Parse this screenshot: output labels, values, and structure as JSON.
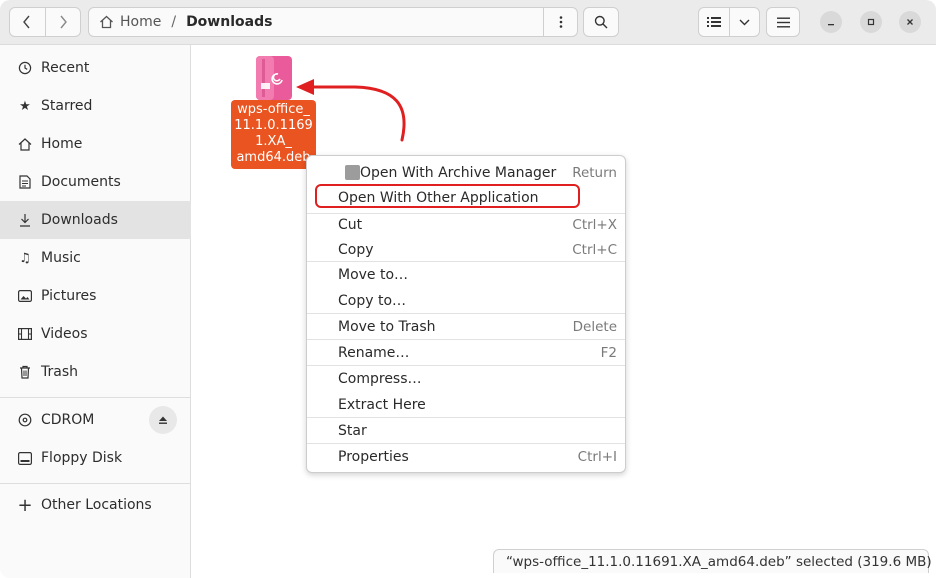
{
  "header": {
    "back_icon": "chevron-left-icon",
    "forward_icon": "chevron-right-icon",
    "path_home": "Home",
    "path_separator": "/",
    "path_current": "Downloads",
    "path_menu_icon": "vertical-dots-icon",
    "search_icon": "search-icon",
    "view_list_icon": "list-view-icon",
    "view_dropdown_icon": "chevron-down-icon",
    "menu_icon": "hamburger-menu-icon",
    "minimize_icon": "minimize-icon",
    "maximize_icon": "maximize-icon",
    "close_icon": "close-icon"
  },
  "sidebar": {
    "items": [
      {
        "label": "Recent",
        "icon": "clock-icon"
      },
      {
        "label": "Starred",
        "icon": "star-icon"
      },
      {
        "label": "Home",
        "icon": "home-icon"
      },
      {
        "label": "Documents",
        "icon": "document-icon"
      },
      {
        "label": "Downloads",
        "icon": "download-icon",
        "active": true
      },
      {
        "label": "Music",
        "icon": "music-icon"
      },
      {
        "label": "Pictures",
        "icon": "picture-icon"
      },
      {
        "label": "Videos",
        "icon": "film-icon"
      },
      {
        "label": "Trash",
        "icon": "trash-icon"
      }
    ],
    "devices": [
      {
        "label": "CDROM",
        "icon": "disc-icon",
        "eject_icon": "eject-icon"
      },
      {
        "label": "Floppy Disk",
        "icon": "drive-icon"
      }
    ],
    "other_locations": {
      "label": "Other Locations",
      "icon": "plus-icon"
    }
  },
  "file": {
    "name_lines": [
      "wps-office_",
      "11.1.0.1169",
      "1.XA_",
      "amd64.deb"
    ],
    "icon": "debian-package-icon"
  },
  "context_menu": {
    "items": [
      {
        "label": "Open With Archive Manager",
        "accel": "Return",
        "icon": "archive-manager-icon"
      },
      {
        "label": "Open With Other Application",
        "accel": ""
      },
      {
        "label": "Cut",
        "accel": "Ctrl+X"
      },
      {
        "label": "Copy",
        "accel": "Ctrl+C"
      },
      {
        "label": "Move to…",
        "accel": ""
      },
      {
        "label": "Copy to…",
        "accel": ""
      },
      {
        "label": "Move to Trash",
        "accel": "Delete"
      },
      {
        "label": "Rename…",
        "accel": "F2"
      },
      {
        "label": "Compress…",
        "accel": ""
      },
      {
        "label": "Extract Here",
        "accel": ""
      },
      {
        "label": "Star",
        "accel": ""
      },
      {
        "label": "Properties",
        "accel": "Ctrl+I"
      }
    ]
  },
  "status": {
    "text": "“wps-office_11.1.0.11691.XA_amd64.deb” selected  (319.6 MB)"
  },
  "colors": {
    "accent": "#e95420",
    "annotation": "#e02020",
    "sidebar_active": "#e3e3e3"
  }
}
